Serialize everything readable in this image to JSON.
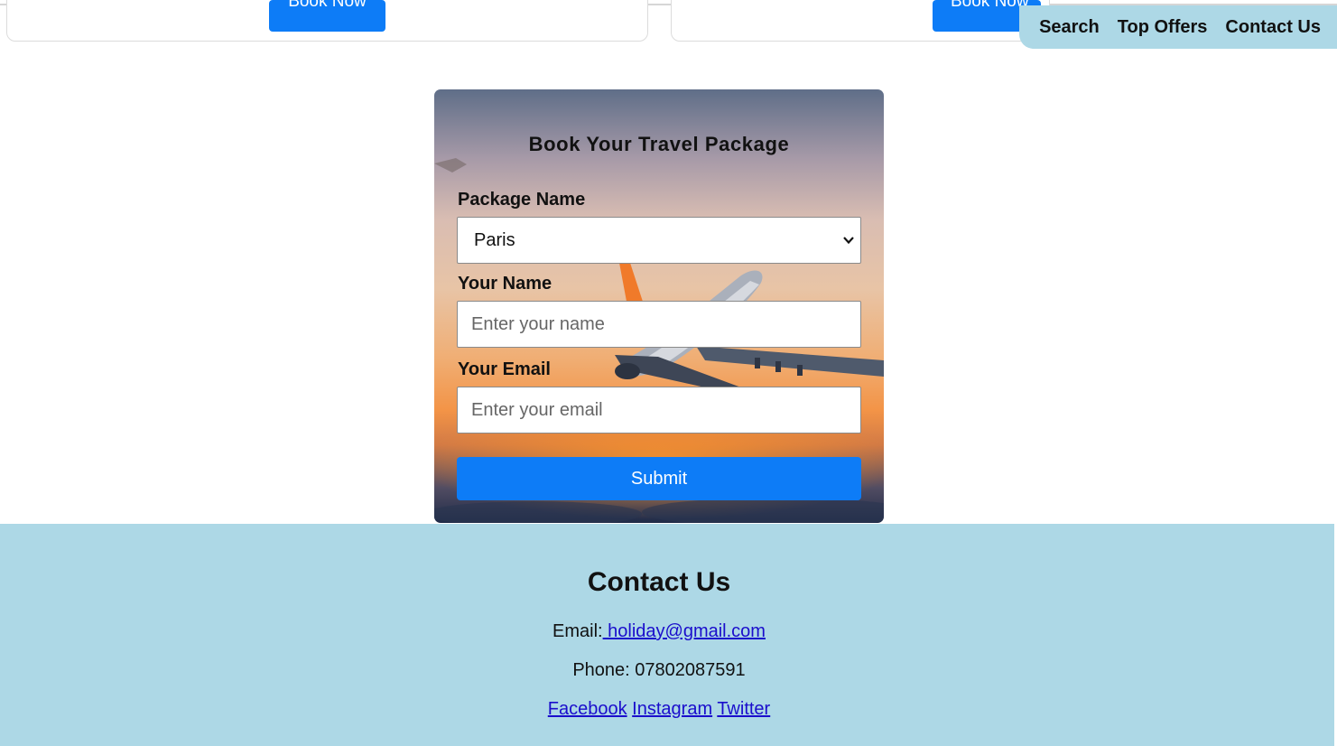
{
  "cards": {
    "book_now_1": "Book Now",
    "book_now_2": "Book Now"
  },
  "nav": {
    "search": "Search",
    "top_offers": "Top Offers",
    "contact_us": "Contact Us"
  },
  "booking_form": {
    "title": "Book Your Travel Package",
    "package_label": "Package Name",
    "package_selected": "Paris",
    "name_label": "Your Name",
    "name_placeholder": "Enter your name",
    "email_label": "Your Email",
    "email_placeholder": "Enter your email",
    "submit_label": "Submit"
  },
  "footer": {
    "title": "Contact Us",
    "email_prefix": "Email:",
    "email_link": " holiday@gmail.com",
    "phone": "Phone: 07802087591",
    "social": {
      "facebook": "Facebook",
      "instagram": "Instagram",
      "twitter": "Twitter"
    }
  },
  "colors": {
    "accent_blue": "#0d7cf7",
    "nav_footer_bg": "#add8e6",
    "link": "#1a0dcc"
  }
}
